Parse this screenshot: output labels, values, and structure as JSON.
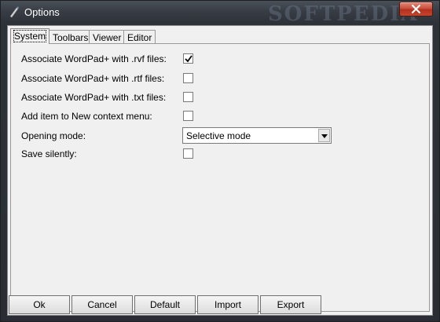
{
  "window": {
    "title": "Options",
    "watermark": "SOFTPEDIA"
  },
  "tabs": [
    "System",
    "Toolbars",
    "Viewer",
    "Editor"
  ],
  "active_tab": "System",
  "options": [
    {
      "label": "Associate WordPad+ with .rvf files:",
      "checked": true
    },
    {
      "label": "Associate WordPad+ with .rtf files:",
      "checked": false
    },
    {
      "label": "Associate WordPad+ with .txt files:",
      "checked": false
    },
    {
      "label": "Add item to New context menu:",
      "checked": false
    }
  ],
  "opening_mode": {
    "label": "Opening mode:",
    "value": "Selective mode"
  },
  "save_silently": {
    "label": "Save silently:",
    "checked": false
  },
  "buttons": {
    "ok": "Ok",
    "cancel": "Cancel",
    "default": "Default",
    "import": "Import",
    "export": "Export"
  },
  "colors": {
    "close_button": "#c9503d",
    "title_bar": "#383d45",
    "dialog_bg": "#f0f0f0"
  }
}
